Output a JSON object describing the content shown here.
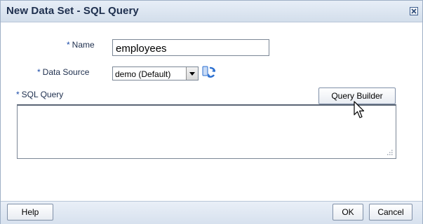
{
  "dialog": {
    "title": "New Data Set - SQL Query"
  },
  "form": {
    "name": {
      "required_mark": "*",
      "label": "Name",
      "value": "employees"
    },
    "data_source": {
      "required_mark": "*",
      "label": "Data Source",
      "selected": "demo (Default)"
    },
    "sql_query": {
      "required_mark": "*",
      "label": "SQL Query",
      "value": "",
      "query_builder_label": "Query Builder"
    }
  },
  "footer": {
    "help_label": "Help",
    "ok_label": "OK",
    "cancel_label": "Cancel"
  },
  "icons": {
    "close": "close-icon",
    "refresh": "refresh-icon",
    "dropdown": "chevron-down-icon",
    "cursor": "mouse-pointer-icon",
    "resize": "resize-grip-icon"
  },
  "colors": {
    "title_text": "#1d2e4d",
    "required_mark": "#1a4aa8",
    "titlebar_bg": "#dbe4f0",
    "refresh_blue": "#2b6fd0"
  }
}
